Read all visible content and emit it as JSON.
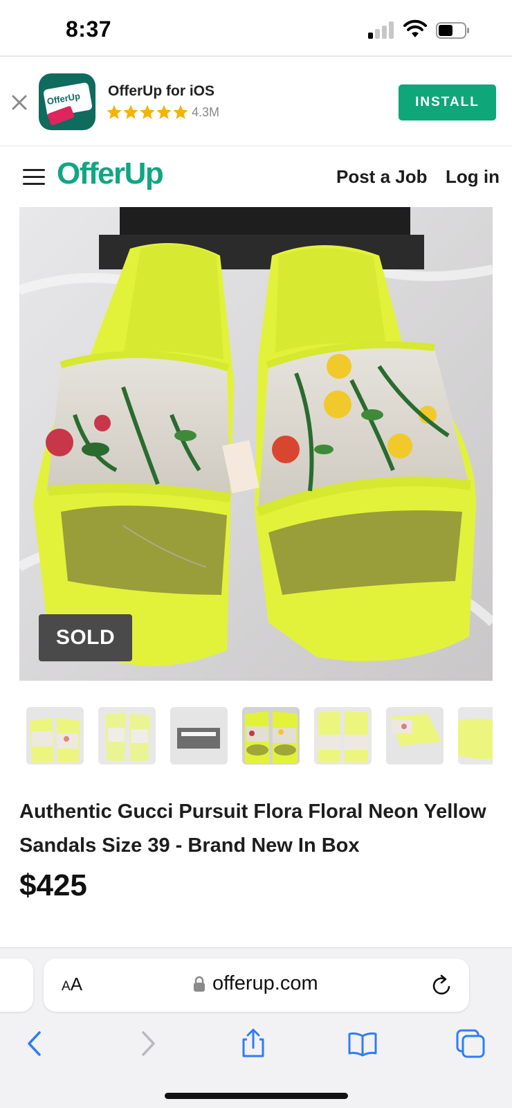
{
  "status_bar": {
    "time": "8:37",
    "icons": [
      "cellular-signal-icon",
      "wifi-icon",
      "battery-icon"
    ]
  },
  "app_banner": {
    "app_name": "OfferUp for iOS",
    "icon_label": "OfferUp",
    "rating_stars": 5,
    "rating_count": "4.3M",
    "install_label": "INSTALL",
    "install_color": "#0fa67a"
  },
  "nav": {
    "logo": "OfferUp",
    "logo_color": "#11a683",
    "post_job_label": "Post a Job",
    "login_label": "Log in"
  },
  "listing": {
    "badge": "SOLD",
    "thumbnail_count": 7,
    "selected_thumbnail": 4,
    "title": "Authentic Gucci Pursuit Flora Floral Neon Yellow Sandals Size 39 - Brand New In Box",
    "price": "$425"
  },
  "browser": {
    "text_size_label": "AA",
    "url": "offerup.com",
    "toolbar": [
      "back-icon",
      "forward-icon",
      "share-icon",
      "bookmarks-icon",
      "tabs-icon"
    ]
  }
}
